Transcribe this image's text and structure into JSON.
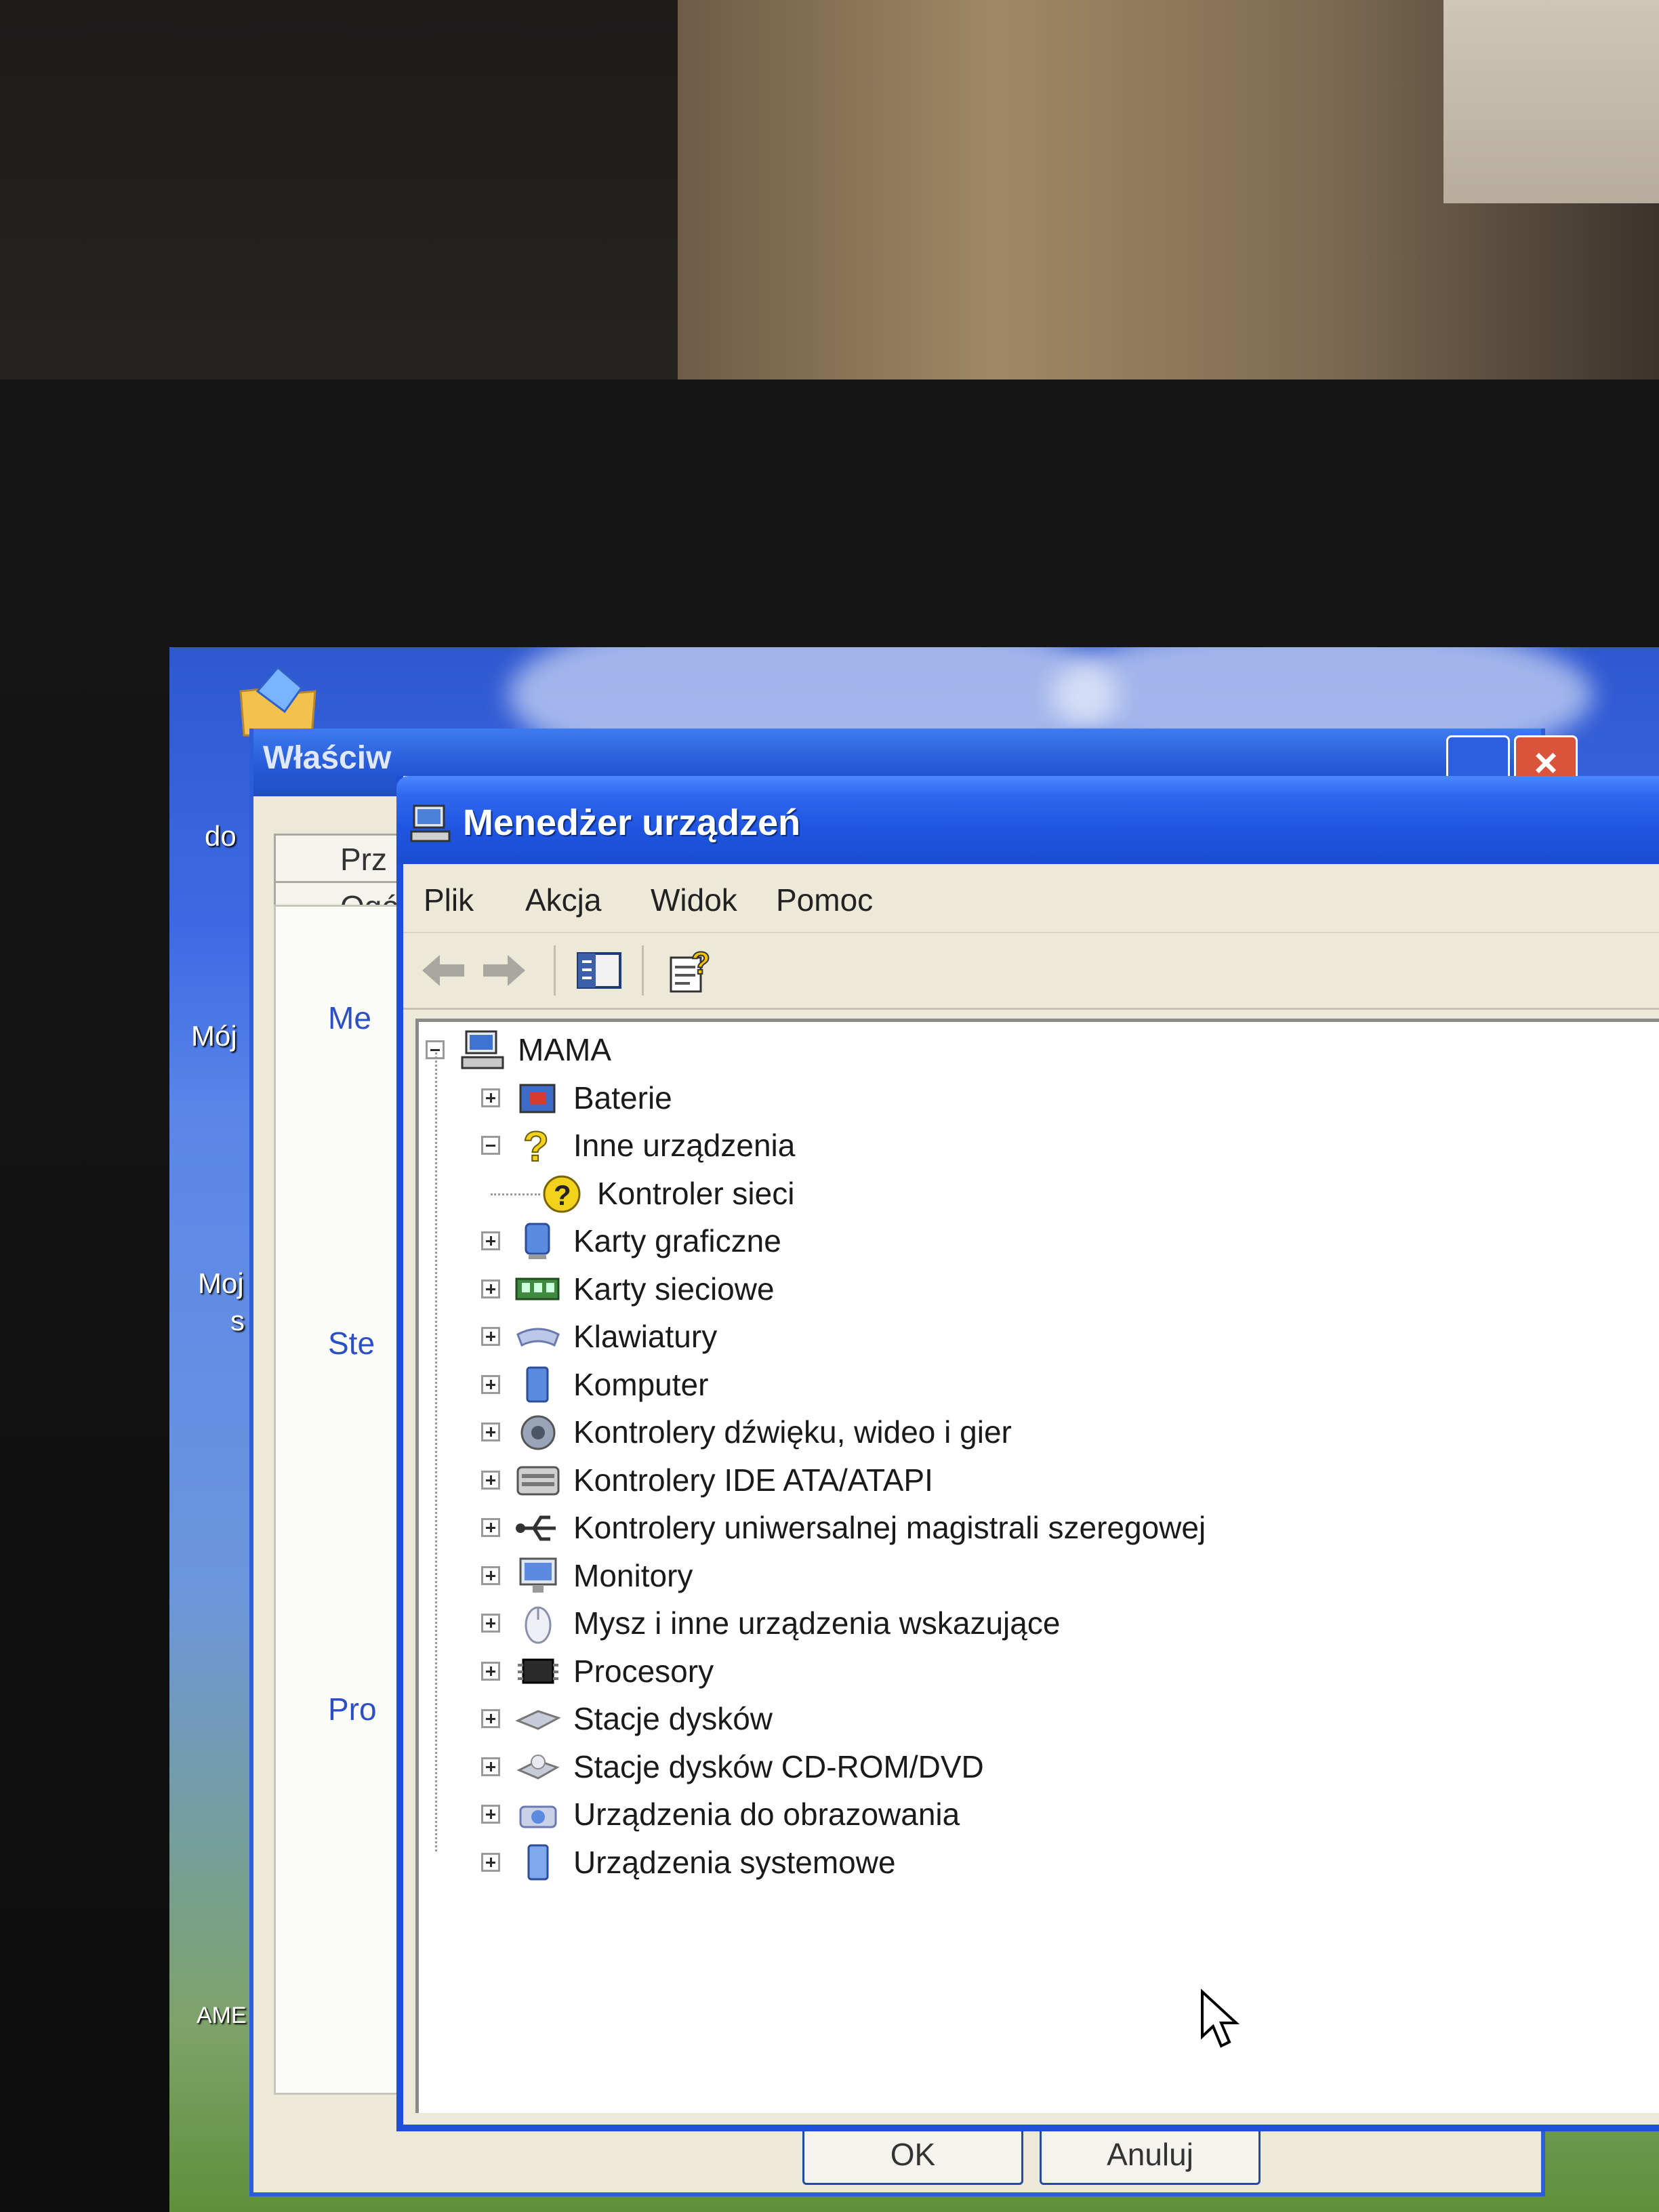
{
  "back_window": {
    "title": "Właściw",
    "tabs": [
      "Prz",
      "Ogó"
    ],
    "sections": [
      "Me",
      "Ste",
      "Pro"
    ],
    "buttons": [
      "OK",
      "Anuluj"
    ]
  },
  "desktop": {
    "labels": [
      "do",
      "Mój",
      "Moj",
      "s",
      "AME"
    ]
  },
  "window": {
    "title": "Menedżer urządzeń"
  },
  "menu": {
    "items": [
      "Plik",
      "Akcja",
      "Widok",
      "Pomoc"
    ]
  },
  "toolbar": {
    "buttons": [
      "back-arrow-icon",
      "forward-arrow-icon",
      "show-hide-tree-icon",
      "properties-help-icon"
    ]
  },
  "tree": {
    "root": "MAMA",
    "categories": [
      {
        "label": "Baterie",
        "icon": "battery-icon",
        "expanded": false
      },
      {
        "label": "Inne urządzenia",
        "icon": "unknown-device-icon",
        "expanded": true,
        "children": [
          "Kontroler sieci"
        ]
      },
      {
        "label": "Karty graficzne",
        "icon": "display-adapter-icon",
        "expanded": false
      },
      {
        "label": "Karty sieciowe",
        "icon": "network-adapter-icon",
        "expanded": false
      },
      {
        "label": "Klawiatury",
        "icon": "keyboard-icon",
        "expanded": false
      },
      {
        "label": "Komputer",
        "icon": "computer-icon",
        "expanded": false
      },
      {
        "label": "Kontrolery dźwięku, wideo i gier",
        "icon": "sound-icon",
        "expanded": false
      },
      {
        "label": "Kontrolery IDE ATA/ATAPI",
        "icon": "ide-controller-icon",
        "expanded": false
      },
      {
        "label": "Kontrolery uniwersalnej magistrali szeregowej",
        "icon": "usb-icon",
        "expanded": false
      },
      {
        "label": "Monitory",
        "icon": "monitor-icon",
        "expanded": false
      },
      {
        "label": "Mysz i inne urządzenia wskazujące",
        "icon": "mouse-icon",
        "expanded": false
      },
      {
        "label": "Procesory",
        "icon": "processor-icon",
        "expanded": false
      },
      {
        "label": "Stacje dysków",
        "icon": "floppy-drive-icon",
        "expanded": false
      },
      {
        "label": "Stacje dysków CD-ROM/DVD",
        "icon": "cdrom-icon",
        "expanded": false
      },
      {
        "label": "Urządzenia do obrazowania",
        "icon": "imaging-device-icon",
        "expanded": false
      },
      {
        "label": "Urządzenia systemowe",
        "icon": "system-device-icon",
        "expanded": false
      }
    ]
  },
  "colors": {
    "titlebar": "#1f55e0",
    "window_bg": "#ece9d8",
    "tree_bg": "#ffffff",
    "link_blue": "#2b4fc4",
    "warning_yellow": "#f2d21b"
  }
}
